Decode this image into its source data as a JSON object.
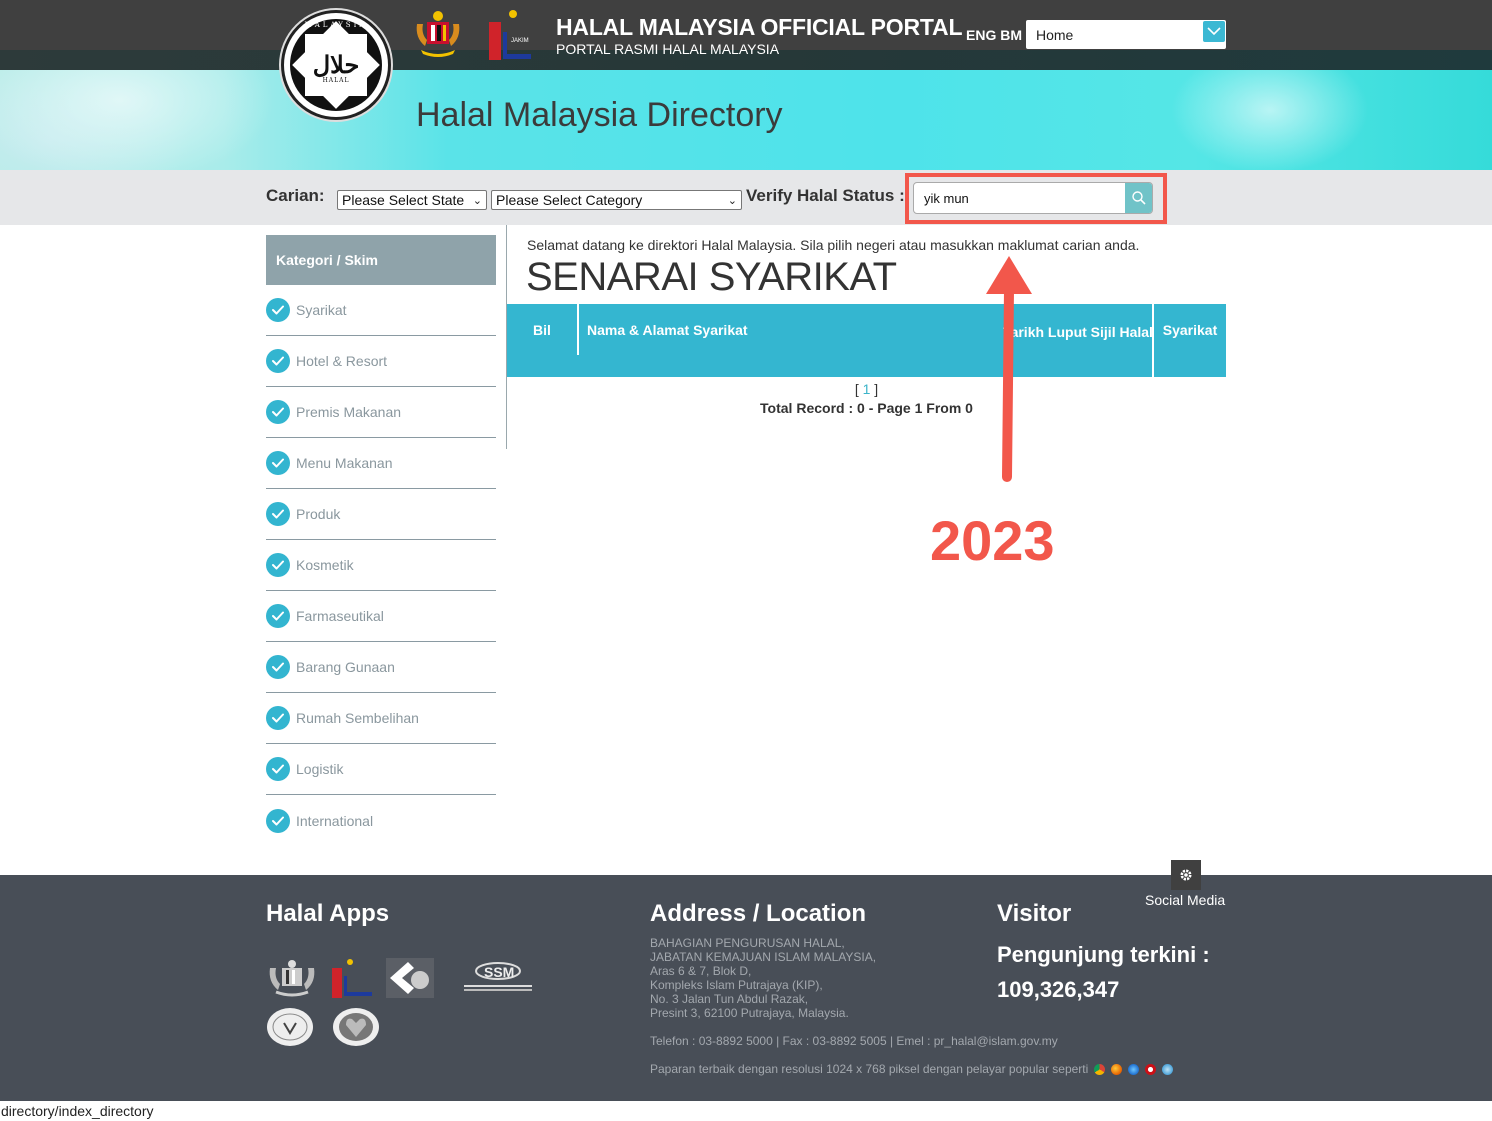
{
  "header": {
    "title": "HALAL MALAYSIA OFFICIAL PORTAL",
    "subtitle": "PORTAL RASMI HALAL MALAYSIA",
    "lang_eng": "ENG",
    "lang_bm": "BM",
    "nav_select_value": "Home",
    "logo_arabic": "حلال",
    "logo_halal": "HALAL",
    "logo_malaysia": "MALAYSIA",
    "jakim_label": "JAKIM"
  },
  "banner": {
    "title": "Halal Malaysia Directory"
  },
  "search": {
    "carian_label": "Carian:",
    "state_select": "Please Select State",
    "category_select": "Please Select Category",
    "verify_label": "Verify Halal Status :",
    "verify_value": "yik mun"
  },
  "sidebar": {
    "heading": "Kategori / Skim",
    "items": [
      {
        "label": "Syarikat"
      },
      {
        "label": "Hotel & Resort"
      },
      {
        "label": "Premis Makanan"
      },
      {
        "label": "Menu Makanan"
      },
      {
        "label": "Produk"
      },
      {
        "label": "Kosmetik"
      },
      {
        "label": "Farmaseutikal"
      },
      {
        "label": "Barang Gunaan"
      },
      {
        "label": "Rumah Sembelihan"
      },
      {
        "label": "Logistik"
      },
      {
        "label": "International"
      }
    ]
  },
  "main": {
    "welcome": "Selamat datang ke direktori Halal Malaysia. Sila pilih negeri atau masukkan maklumat carian anda.",
    "heading": "SENARAI SYARIKAT",
    "table": {
      "columns": [
        "Bil",
        "Nama & Alamat Syarikat",
        "Tarikh Luput Sijil Halal",
        "Syarikat"
      ],
      "rows": []
    },
    "pager": {
      "open": "[",
      "page": "1",
      "close": "]"
    },
    "total": "Total Record : 0 - Page 1 From 0"
  },
  "annotation": {
    "year": "2023",
    "color": "#f2574b"
  },
  "footer": {
    "social_label": "Social Media",
    "apps_heading": "Halal Apps",
    "address_heading": "Address / Location",
    "address_lines": [
      "BAHAGIAN PENGURUSAN HALAL,",
      "JABATAN KEMAJUAN ISLAM MALAYSIA,",
      "Aras 6 & 7, Blok D,",
      "Kompleks Islam Putrajaya (KIP),",
      "No. 3 Jalan Tun Abdul Razak,",
      "Presint 3, 62100 Putrajaya, Malaysia."
    ],
    "contact": "Telefon : 03-8892 5000 | Fax : 03-8892 5005 | Emel : pr_halal@islam.gov.my",
    "best_view": "Paparan terbaik dengan resolusi 1024 x 768 piksel dengan pelayar popular seperti",
    "visitor_heading": "Visitor",
    "visitor_label": "Pengunjung terkini :",
    "visitor_count": "109,326,347"
  },
  "statusbar": {
    "url": "directory/index_directory"
  },
  "colors": {
    "accent": "#34b6d0",
    "sidebar_head": "#8fa3aa",
    "footer_bg": "#484e57",
    "header_bg": "#404040"
  }
}
